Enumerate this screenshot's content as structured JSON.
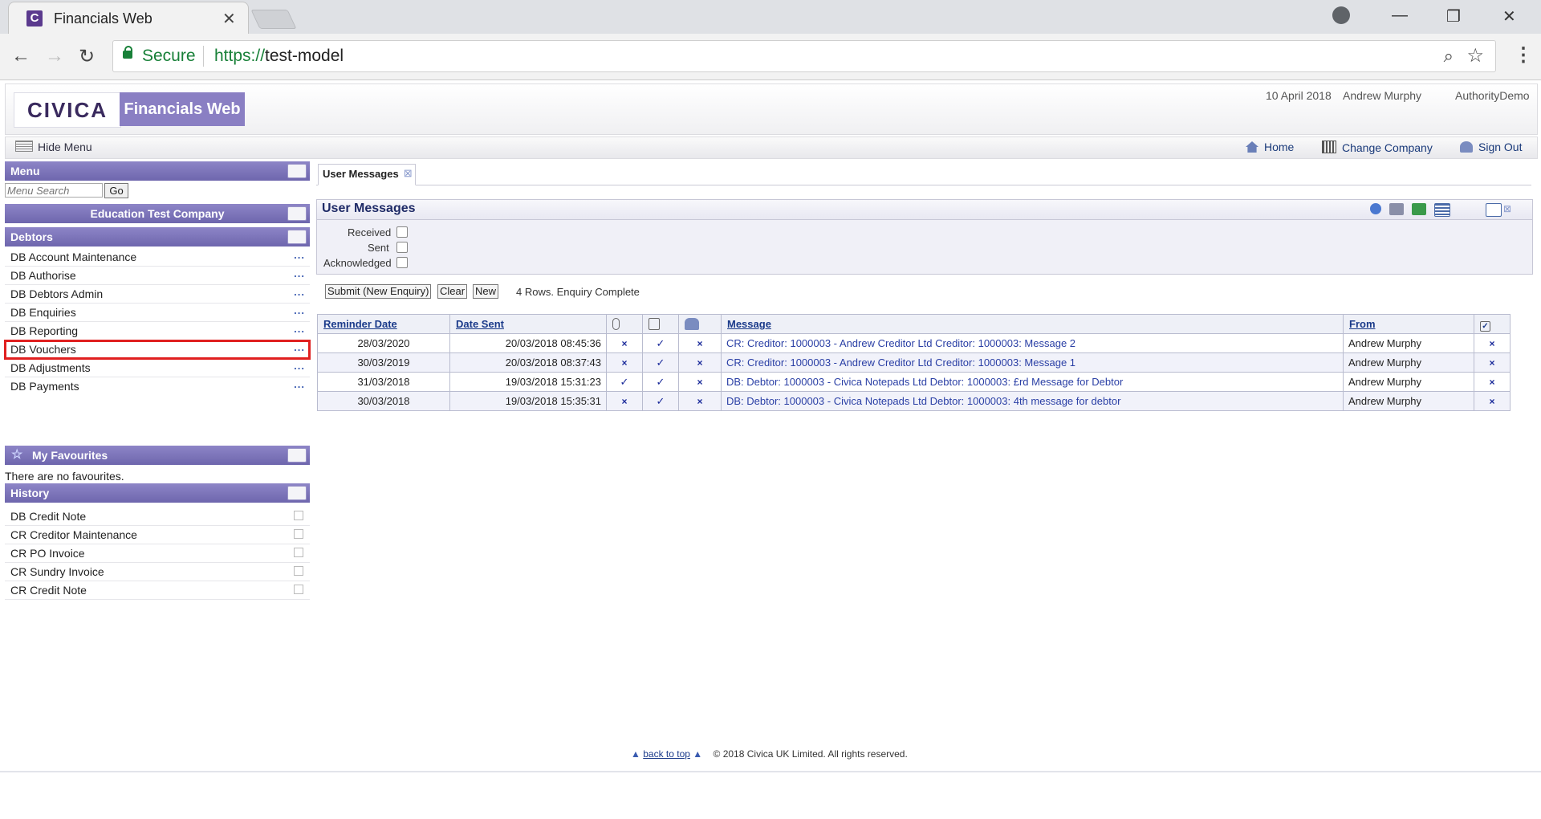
{
  "browser": {
    "tab_title": "Financials Web",
    "favicon_letter": "C",
    "secure_label": "Secure",
    "url_scheme": "https://",
    "url_host": "test-model"
  },
  "header": {
    "logo_text": "CIVICA",
    "product_name": "Financials Web",
    "date": "10 April 2018",
    "user": "Andrew Murphy",
    "authority": "AuthorityDemo",
    "hide_menu": "Hide Menu",
    "home": "Home",
    "change_company": "Change Company",
    "sign_out": "Sign Out"
  },
  "sidebar": {
    "menu_title": "Menu",
    "search_placeholder": "Menu Search",
    "go_label": "Go",
    "company": "Education Test Company",
    "section": "Debtors",
    "more": "...",
    "items": [
      {
        "label": "DB Account Maintenance"
      },
      {
        "label": "DB Authorise"
      },
      {
        "label": "DB Debtors Admin"
      },
      {
        "label": "DB Enquiries"
      },
      {
        "label": "DB Reporting"
      },
      {
        "label": "DB Vouchers"
      },
      {
        "label": "DB Adjustments"
      },
      {
        "label": "DB Payments"
      }
    ],
    "favourites_title": "My Favourites",
    "favourites_empty": "There are no favourites.",
    "history_title": "History",
    "history": [
      {
        "label": "DB Credit Note"
      },
      {
        "label": "CR Creditor Maintenance"
      },
      {
        "label": "CR PO Invoice"
      },
      {
        "label": "CR Sundry Invoice"
      },
      {
        "label": "CR Credit Note"
      }
    ]
  },
  "main": {
    "tab_label": "User Messages",
    "panel_title": "User Messages",
    "filters": {
      "received": "Received",
      "sent": "Sent",
      "acknowledged": "Acknowledged"
    },
    "buttons": {
      "submit": "Submit (New Enquiry)",
      "clear": "Clear",
      "new": "New"
    },
    "status": "4 Rows. Enquiry Complete",
    "columns": {
      "reminder_date": "Reminder Date",
      "date_sent": "Date Sent",
      "message": "Message",
      "from": "From"
    },
    "rows": [
      {
        "reminder": "28/03/2020",
        "sent": "20/03/2018 08:45:36",
        "attach": "×",
        "note": "✓",
        "group": "×",
        "message": "CR: Creditor: 1000003 - Andrew Creditor Ltd Creditor: 1000003: Message 2",
        "from": "Andrew Murphy",
        "ack": "×"
      },
      {
        "reminder": "30/03/2019",
        "sent": "20/03/2018 08:37:43",
        "attach": "×",
        "note": "✓",
        "group": "×",
        "message": "CR: Creditor: 1000003 - Andrew Creditor Ltd Creditor: 1000003: Message 1",
        "from": "Andrew Murphy",
        "ack": "×"
      },
      {
        "reminder": "31/03/2018",
        "sent": "19/03/2018 15:31:23",
        "attach": "✓",
        "note": "✓",
        "group": "×",
        "message": "DB: Debtor: 1000003 - Civica Notepads Ltd Debtor: 1000003: £rd Message for Debtor",
        "from": "Andrew Murphy",
        "ack": "×"
      },
      {
        "reminder": "30/03/2018",
        "sent": "19/03/2018 15:35:31",
        "attach": "×",
        "note": "✓",
        "group": "×",
        "message": "DB: Debtor: 1000003 - Civica Notepads Ltd Debtor: 1000003: 4th message for debtor",
        "from": "Andrew Murphy",
        "ack": "×"
      }
    ]
  },
  "footer": {
    "back_to_top": "back to top",
    "copyright": "© 2018 Civica UK Limited. All rights reserved."
  }
}
